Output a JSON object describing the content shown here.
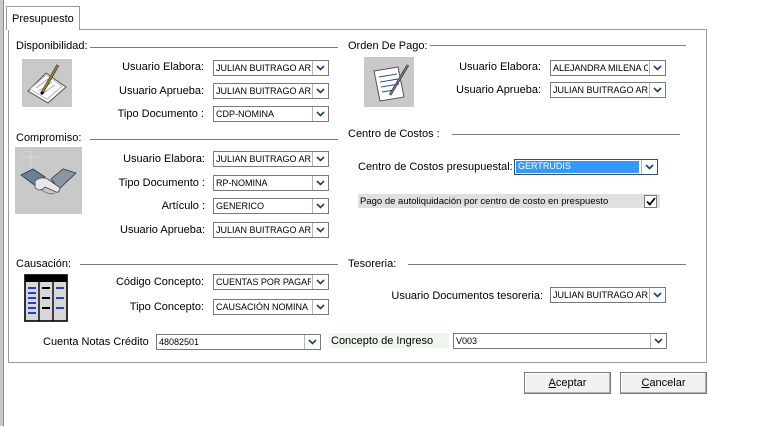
{
  "tab": {
    "label": "Presupuesto"
  },
  "disponibilidad": {
    "title": "Disponibilidad:",
    "usuario_elabora_label": "Usuario Elabora:",
    "usuario_elabora_value": "JULIAN BUITRAGO ARANGO",
    "usuario_aprueba_label": "Usuario Aprueba:",
    "usuario_aprueba_value": "JULIAN BUITRAGO ARANGO",
    "tipo_documento_label": "Tipo Documento :",
    "tipo_documento_value": "CDP-NOMINA"
  },
  "orden_pago": {
    "title": "Orden De Pago:",
    "usuario_elabora_label": "Usuario Elabora:",
    "usuario_elabora_value": "ALEJANDRA MILENA C",
    "usuario_aprueba_label": "Usuario Aprueba:",
    "usuario_aprueba_value": "JULIAN BUITRAGO ARANGO"
  },
  "compromiso": {
    "title": "Compromiso:",
    "usuario_elabora_label": "Usuario Elabora:",
    "usuario_elabora_value": "JULIAN BUITRAGO ARANGO",
    "tipo_documento_label": "Tipo Documento :",
    "tipo_documento_value": "RP-NOMINA",
    "articulo_label": "Artículo :",
    "articulo_value": "GENERICO",
    "usuario_aprueba_label": "Usuario Aprueba:",
    "usuario_aprueba_value": "JULIAN BUITRAGO ARANGO"
  },
  "centro_costos": {
    "title": "Centro de Costos :",
    "presupuestal_label": "Centro de Costos presupuestal:",
    "presupuestal_value": "GERTRUDIS",
    "autoliquidacion_label": "Pago de autoliquidación por centro de costo en prespuesto",
    "autoliquidacion_checked": true
  },
  "causacion": {
    "title": "Causación:",
    "codigo_concepto_label": "Código Concepto:",
    "codigo_concepto_value": "CUENTAS POR PAGAR",
    "tipo_concepto_label": "Tipo Concepto:",
    "tipo_concepto_value": "CAUSACIÓN NOMINA"
  },
  "tesoreria": {
    "title": "Tesoreria:",
    "usuario_documentos_label": "Usuario Documentos tesoreria:",
    "usuario_documentos_value": "JULIAN BUITRAGO ARANGO"
  },
  "bottom": {
    "cuenta_notas_label": "Cuenta Notas Crédito",
    "cuenta_notas_value": "48082501",
    "concepto_ingreso_label": "Concepto de Ingreso",
    "concepto_ingreso_value": "V003"
  },
  "buttons": {
    "aceptar_first": "A",
    "aceptar_rest": "ceptar",
    "cancelar_first": "C",
    "cancelar_rest": "ancelar"
  },
  "colors": {
    "selection": "#3399ff",
    "highlight_label_bg": "#eef7ee",
    "checkbox_row_bg": "#e0e0e0"
  },
  "icons": [
    "document-sign-icon",
    "order-sign-icon",
    "handshake-icon",
    "ledger-icon",
    "chevron-down-icon",
    "checkmark-icon"
  ]
}
